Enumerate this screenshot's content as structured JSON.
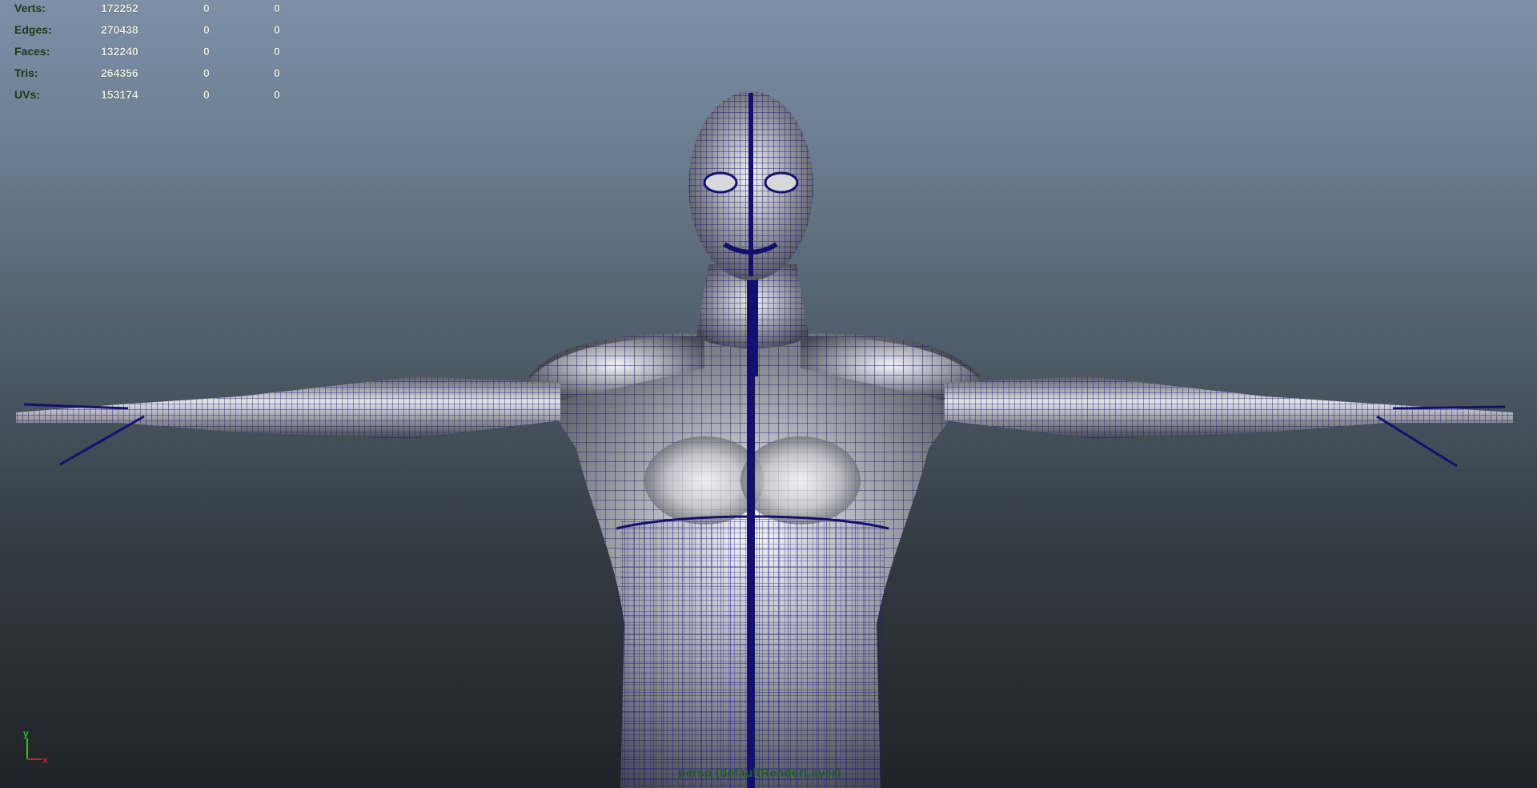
{
  "hud": {
    "rows": [
      {
        "label": "Verts:",
        "v1": "172252",
        "v2": "0",
        "v3": "0"
      },
      {
        "label": "Edges:",
        "v1": "270438",
        "v2": "0",
        "v3": "0"
      },
      {
        "label": "Faces:",
        "v1": "132240",
        "v2": "0",
        "v3": "0"
      },
      {
        "label": "Tris:",
        "v1": "264356",
        "v2": "0",
        "v3": "0"
      },
      {
        "label": "UVs:",
        "v1": "153174",
        "v2": "0",
        "v3": "0"
      }
    ]
  },
  "axis": {
    "y_label": "y",
    "x_label": "x",
    "y_color": "#2ec22e",
    "x_color": "#d02020"
  },
  "viewport": {
    "camera_label": "persp (defaultRenderLayer)",
    "wire_color": "#1a1a8c",
    "icon": "3d-mesh-wireframe"
  }
}
